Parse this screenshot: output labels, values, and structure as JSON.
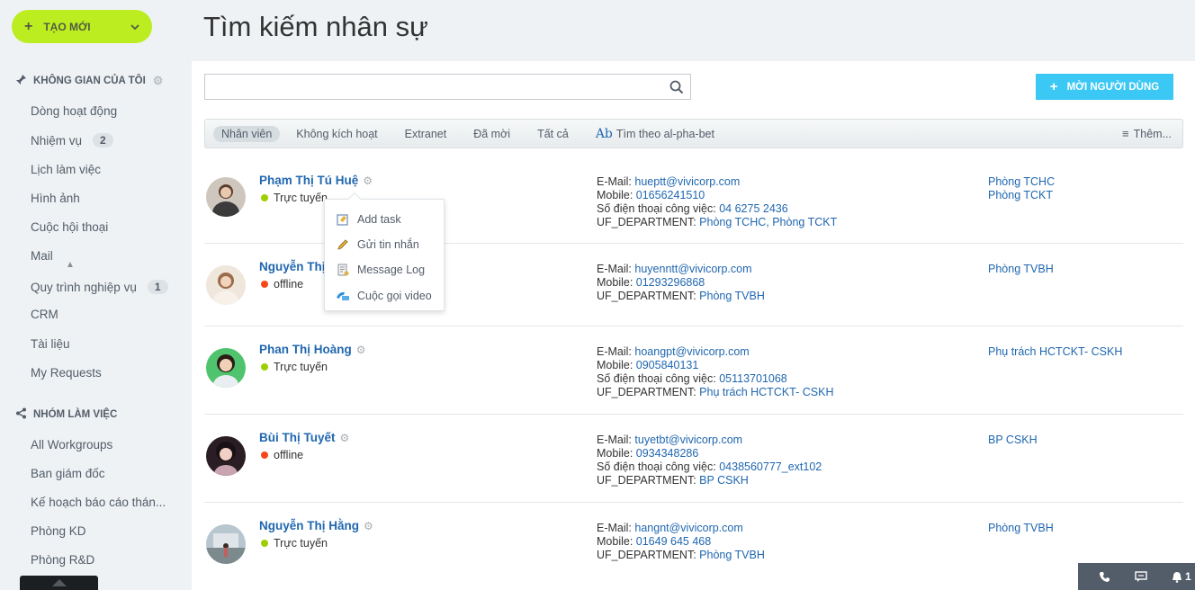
{
  "sidebar": {
    "create_label": "TẠO MỚI",
    "my_space_title": "KHÔNG GIAN CỦA TÔI",
    "items": [
      {
        "label": "Dòng hoạt động",
        "count": ""
      },
      {
        "label": "Nhiệm vụ",
        "count": "2"
      },
      {
        "label": "Lịch làm việc",
        "count": ""
      },
      {
        "label": "Hình ảnh",
        "count": ""
      },
      {
        "label": "Cuộc hội thoại",
        "count": ""
      },
      {
        "label": "Mail",
        "count": ""
      },
      {
        "label": "Quy trình nghiệp vụ",
        "count": "1"
      },
      {
        "label": "CRM",
        "count": ""
      },
      {
        "label": "Tài liệu",
        "count": ""
      },
      {
        "label": "My Requests",
        "count": ""
      }
    ],
    "workgroups_title": "NHÓM LÀM VIỆC",
    "groups": [
      {
        "label": "All Workgroups"
      },
      {
        "label": "Ban giám đốc"
      },
      {
        "label": "Kế hoạch báo cáo thán..."
      },
      {
        "label": "Phòng KD"
      },
      {
        "label": "Phòng R&D"
      }
    ]
  },
  "page": {
    "title": "Tìm kiếm nhân sự",
    "search_value": "",
    "invite_label": "MỜI NGƯỜI DÙNG"
  },
  "filters": {
    "items": [
      "Nhân viên",
      "Không kích hoạt",
      "Extranet",
      "Đã mời",
      "Tất cả"
    ],
    "alpha_icon": "Ab",
    "alpha_label": "Tìm theo al-pha-bet",
    "more_label": "Thêm..."
  },
  "employees": [
    {
      "name": "Phạm Thị Tú Huệ",
      "status": "Trực tuyến",
      "email_label": "E-Mail:",
      "email": "hueptt@vivicorp.com",
      "mobile_label": "Mobile:",
      "mobile": "01656241510",
      "work_phone_label": "Số điện thoại công việc:",
      "work_phone": "04 6275 2436",
      "dept_label": "UF_DEPARTMENT:",
      "dept": "Phòng TCHC, Phòng TCKT",
      "departments": [
        "Phòng TCHC",
        "Phòng TCKT"
      ]
    },
    {
      "name": "Nguyễn Thị",
      "status": "offline",
      "email_label": "E-Mail:",
      "email": "huyenntt@vivicorp.com",
      "mobile_label": "Mobile:",
      "mobile": "01293296868",
      "work_phone_label": "",
      "work_phone": "",
      "dept_label": "UF_DEPARTMENT:",
      "dept": "Phòng TVBH",
      "departments": [
        "Phòng TVBH"
      ]
    },
    {
      "name": "Phan Thị Hoàng",
      "status": "Trực tuyến",
      "email_label": "E-Mail:",
      "email": "hoangpt@vivicorp.com",
      "mobile_label": "Mobile:",
      "mobile": "0905840131",
      "work_phone_label": "Số điện thoại công việc:",
      "work_phone": "05113701068",
      "dept_label": "UF_DEPARTMENT:",
      "dept": "Phụ trách HCTCKT- CSKH",
      "departments": [
        "Phụ trách HCTCKT- CSKH"
      ]
    },
    {
      "name": "Bùi Thị Tuyết",
      "status": "offline",
      "email_label": "E-Mail:",
      "email": "tuyetbt@vivicorp.com",
      "mobile_label": "Mobile:",
      "mobile": "0934348286",
      "work_phone_label": "Số điện thoại công việc:",
      "work_phone": "0438560777_ext102",
      "dept_label": "UF_DEPARTMENT:",
      "dept": "BP CSKH",
      "departments": [
        "BP CSKH"
      ]
    },
    {
      "name": "Nguyễn Thị Hằng",
      "status": "Trực tuyến",
      "email_label": "E-Mail:",
      "email": "hangnt@vivicorp.com",
      "mobile_label": "Mobile:",
      "mobile": "01649 645 468",
      "work_phone_label": "",
      "work_phone": "",
      "dept_label": "UF_DEPARTMENT:",
      "dept": "Phòng TVBH",
      "departments": [
        "Phòng TVBH"
      ]
    }
  ],
  "popup": {
    "items": [
      {
        "label": "Add task",
        "icon": "task-icon"
      },
      {
        "label": "Gửi tin nhắn",
        "icon": "pencil-icon"
      },
      {
        "label": "Message Log",
        "icon": "log-icon"
      },
      {
        "label": "Cuộc gọi video",
        "icon": "video-call-icon"
      }
    ]
  },
  "bottom_bar": {
    "notification_count": "1"
  },
  "colors": {
    "accent_green": "#bbed21",
    "accent_blue": "#3bc8f5",
    "link": "#2067b0",
    "online": "#9dcf00",
    "offline": "#f54819"
  }
}
